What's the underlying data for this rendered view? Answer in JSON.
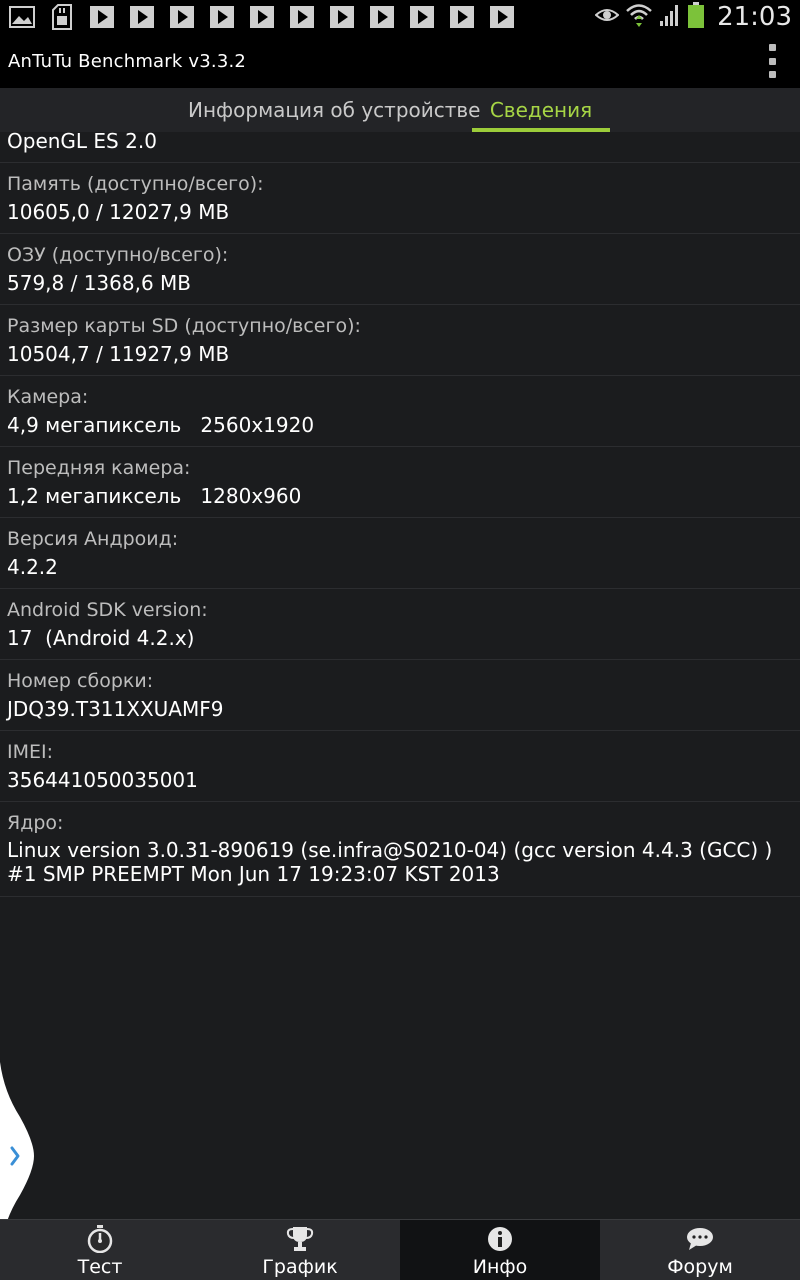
{
  "status_bar": {
    "time": "21:03",
    "left_icons": [
      "gallery-icon",
      "sd-card-icon",
      "play-icon",
      "play-icon",
      "play-icon",
      "play-icon",
      "play-icon",
      "play-icon",
      "play-icon",
      "play-icon",
      "play-icon",
      "play-icon",
      "play-icon"
    ],
    "right_icons": [
      "eye-icon",
      "wifi-icon",
      "signal-icon",
      "battery-icon"
    ]
  },
  "app_bar": {
    "title": "AnTuTu Benchmark v3.3.2"
  },
  "tabs": [
    {
      "label": "Информация об устройстве",
      "active": false
    },
    {
      "label": "Сведения",
      "active": true
    }
  ],
  "colors": {
    "accent": "#9ccc3a",
    "background": "#1b1c1e"
  },
  "info": {
    "first_line": "OpenGL ES 2.0",
    "items": [
      {
        "label": "Память (доступно/всего):",
        "value": "10605,0 / 12027,9 MB"
      },
      {
        "label": "ОЗУ (доступно/всего):",
        "value": "579,8 / 1368,6 MB"
      },
      {
        "label": "Размер карты SD (доступно/всего):",
        "value": "10504,7 / 11927,9 MB"
      },
      {
        "label": "Камера:",
        "value": "4,9 мегапиксель   2560x1920"
      },
      {
        "label": "Передняя камера:",
        "value": "1,2 мегапиксель   1280x960"
      },
      {
        "label": "Версия Андроид:",
        "value": "4.2.2"
      },
      {
        "label": "Android SDK version:",
        "value": "17  (Android 4.2.x)"
      },
      {
        "label": "Номер сборки:",
        "value": "JDQ39.T311XXUAMF9"
      },
      {
        "label": "IMEI:",
        "value": "356441050035001"
      },
      {
        "label": "Ядро:",
        "value": "Linux version 3.0.31-890619 (se.infra@S0210-04) (gcc version 4.4.3 (GCC) ) #1 SMP PREEMPT Mon Jun 17 19:23:07 KST 2013"
      }
    ]
  },
  "bottom_nav": [
    {
      "label": "Тест",
      "icon": "stopwatch-icon",
      "active": false
    },
    {
      "label": "График",
      "icon": "trophy-icon",
      "active": false
    },
    {
      "label": "Инфо",
      "icon": "info-icon",
      "active": true
    },
    {
      "label": "Форум",
      "icon": "chat-bubble-icon",
      "active": false
    }
  ]
}
